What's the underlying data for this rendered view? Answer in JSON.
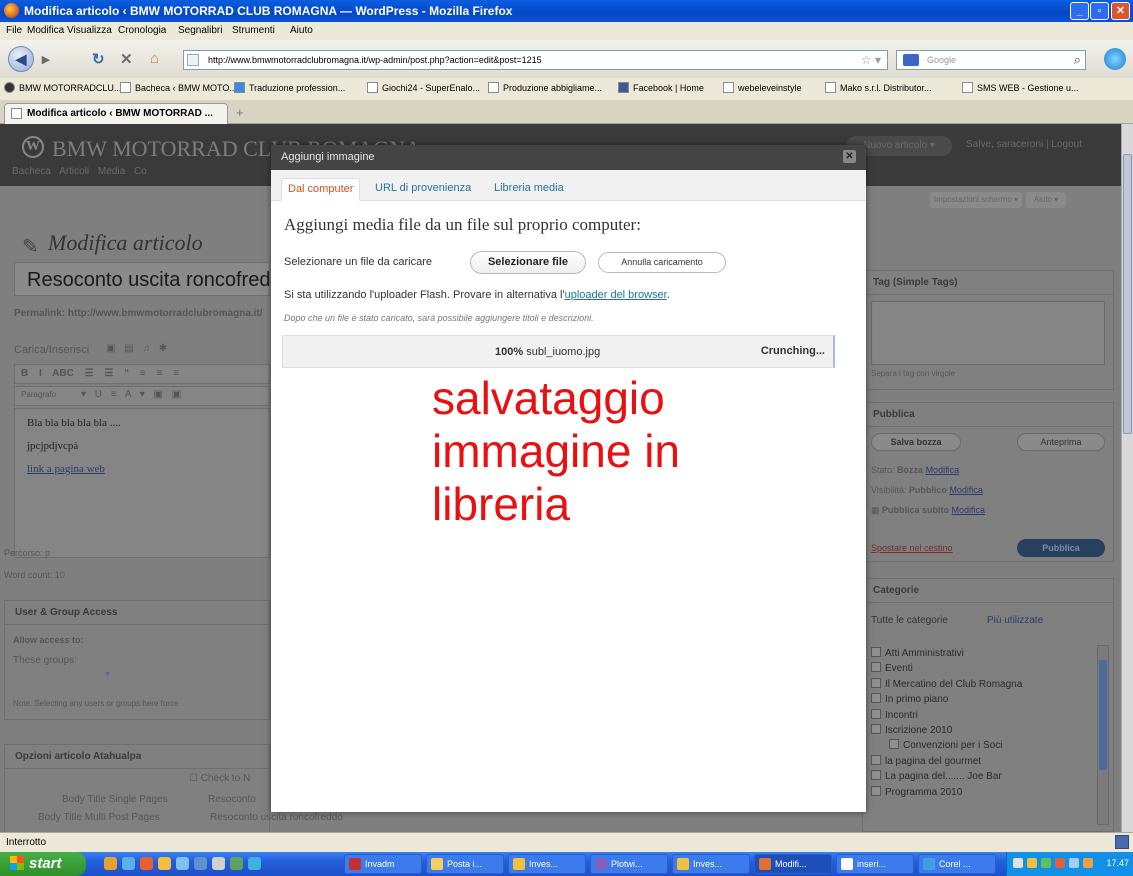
{
  "window": {
    "title": "Modifica articolo ‹ BMW MOTORRAD CLUB ROMAGNA — WordPress - Mozilla Firefox"
  },
  "menu": [
    "File",
    "Modifica",
    "Visualizza",
    "Cronologia",
    "Segnalibri",
    "Strumenti",
    "Aiuto"
  ],
  "url": "http://www.bmwmotorradclubromagna.it/wp-admin/post.php?action=edit&post=1215",
  "search_placeholder": "Google",
  "bookmarks": [
    "BMW MOTORRADCLU...",
    "Bacheca ‹ BMW MOTO...",
    "Traduzione profession...",
    "Giochi24 - SuperEnalo...",
    "Produzione abbigliame...",
    "Facebook | Home",
    "webeleveinstyle",
    "Mako s.r.l. Distributor...",
    "SMS WEB - Gestione u..."
  ],
  "tab_title": "Modifica articolo ‹ BMW MOTORRAD ...",
  "wp": {
    "site_name": "BMW MOTORRAD CLUB ROMAGNA",
    "nav": "Bacheca  Articoli  Media  Co",
    "new_article": "Nuovo articolo",
    "howdy": "Salve, saraceroni | Logout",
    "screen_options": "Impostazioni schermo",
    "help": "Aiuto",
    "page_title": "Modifica articolo",
    "post_title": "Resoconto uscita roncofreddo",
    "permalink": "Permalink: http://www.bmwmotorradclubromagna.it/",
    "upload_insert": "Carica/Inserisci",
    "paragraph": "Paragrafo",
    "editor_lines": [
      "Bla bla bla bla bla ....",
      "jpcjpdjvcpà",
      "link a pagina web"
    ],
    "path": "Percorso: p",
    "word_count": "Word count: 10",
    "user_group_title": "User & Group Access",
    "allow_access": "Allow access to:",
    "these_groups": "These groups:",
    "note": "Note: Selecting any users or groups here force",
    "opzioni_title": "Opzioni articolo Atahualpa",
    "check_to": "Check to N",
    "body_title_single": "Body Title Single Pages",
    "body_title_single_val": "Resoconto",
    "body_title_multi": "Body Title Multi Post Pages",
    "body_title_multi_val": "Resoconto uscita roncofreddo",
    "tags_title": "Tag (Simple Tags)",
    "tags_hint": "Separa i tag con virgole",
    "publish_title": "Pubblica",
    "save_draft": "Salva bozza",
    "preview": "Anteprima",
    "stato_label": "Stato:",
    "stato_value": "Bozza",
    "visib_label": "Visibilità:",
    "visib_value": "Pubblico",
    "publish_immediately": "Pubblica subito",
    "edit_link": "Modifica",
    "trash": "Spostare nel cestino",
    "publish_btn": "Pubblica",
    "categories_title": "Categorie",
    "cat_tab_all": "Tutte le categorie",
    "cat_tab_popular": "Più utilizzate",
    "categories": [
      "Atti Amministrativi",
      "Eventi",
      "Il Mercatino del Club Romagna",
      "In primo piano",
      "Incontri",
      "Iscrizione 2010",
      "Convenzioni per i Soci",
      "la pagina del gourmet",
      "La pagina del....... Joe Bar",
      "Programma 2010"
    ]
  },
  "modal": {
    "title": "Aggiungi immagine",
    "tabs": [
      "Dal computer",
      "URL di provenienza",
      "Libreria media"
    ],
    "heading": "Aggiungi media file da un file sul proprio computer:",
    "select_label": "Selezionare un file da caricare",
    "select_button": "Selezionare file",
    "cancel_button": "Annulla caricamento",
    "flash_info": "Si sta utilizzando l'uploader Flash. Provare in alternativa l'",
    "flash_link": "uploader del browser",
    "flash_end": ".",
    "hint": "Dopo che un file è stato caricato, sarà possibile aggiungere titoli e descrizioni.",
    "progress_pct": "100%",
    "file_name": "subl_iuomo.jpg",
    "status": "Crunching...",
    "progress": 1.0
  },
  "annotation": {
    "lines": [
      "salvataggio",
      "immagine in",
      "libreria"
    ],
    "color": "#e81010"
  },
  "statusbar": "Interrotto",
  "taskbar": {
    "start": "start",
    "buttons": [
      "Invadm",
      "Posta i...",
      "Inves...",
      "Plotwi...",
      "Inves...",
      "Modifi...",
      "inseri...",
      "Corel ..."
    ],
    "clock": "17.47"
  }
}
